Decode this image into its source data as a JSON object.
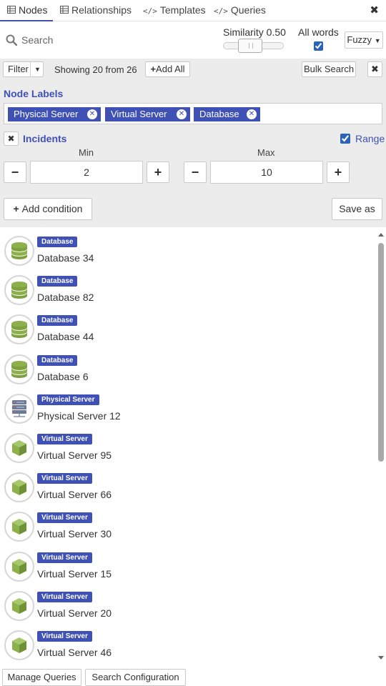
{
  "tabs": [
    {
      "label": "Nodes",
      "icon": "table-icon",
      "active": true
    },
    {
      "label": "Relationships",
      "icon": "table-icon",
      "active": false
    },
    {
      "label": "Templates",
      "icon": "code-icon",
      "active": false
    },
    {
      "label": "Queries",
      "icon": "code-icon",
      "active": false
    }
  ],
  "search": {
    "placeholder": "Search",
    "value": ""
  },
  "similarity": {
    "label": "Similarity 0.50",
    "value": 0.5
  },
  "all_words": {
    "label": "All words",
    "checked": true
  },
  "fuzzy": {
    "label": "Fuzzy"
  },
  "filter": {
    "filter_label": "Filter",
    "showing": "Showing 20 from 26",
    "add_all": "Add All",
    "bulk_search": "Bulk Search",
    "node_labels_title": "Node Labels",
    "chips": [
      "Physical Server",
      "Virtual Server",
      "Database"
    ],
    "incidents_title": "Incidents",
    "range_label": "Range",
    "range_checked": true,
    "min_label": "Min",
    "max_label": "Max",
    "min_value": "2",
    "max_value": "10",
    "add_condition": "Add condition",
    "save_as": "Save as"
  },
  "results": [
    {
      "label": "Database",
      "name": "Database 34",
      "icon": "database-icon"
    },
    {
      "label": "Database",
      "name": "Database 82",
      "icon": "database-icon"
    },
    {
      "label": "Database",
      "name": "Database 44",
      "icon": "database-icon"
    },
    {
      "label": "Database",
      "name": "Database 6",
      "icon": "database-icon"
    },
    {
      "label": "Physical Server",
      "name": "Physical Server 12",
      "icon": "server-rack-icon"
    },
    {
      "label": "Virtual Server",
      "name": "Virtual Server 95",
      "icon": "cube-icon"
    },
    {
      "label": "Virtual Server",
      "name": "Virtual Server 66",
      "icon": "cube-icon"
    },
    {
      "label": "Virtual Server",
      "name": "Virtual Server 30",
      "icon": "cube-icon"
    },
    {
      "label": "Virtual Server",
      "name": "Virtual Server 15",
      "icon": "cube-icon"
    },
    {
      "label": "Virtual Server",
      "name": "Virtual Server 20",
      "icon": "cube-icon"
    },
    {
      "label": "Virtual Server",
      "name": "Virtual Server 46",
      "icon": "cube-icon"
    }
  ],
  "footer": {
    "manage_queries": "Manage Queries",
    "search_configuration": "Search Configuration"
  },
  "colors": {
    "accent": "#3f51b5",
    "panel_bg": "#ececec",
    "icon_green": "#8db04a"
  }
}
